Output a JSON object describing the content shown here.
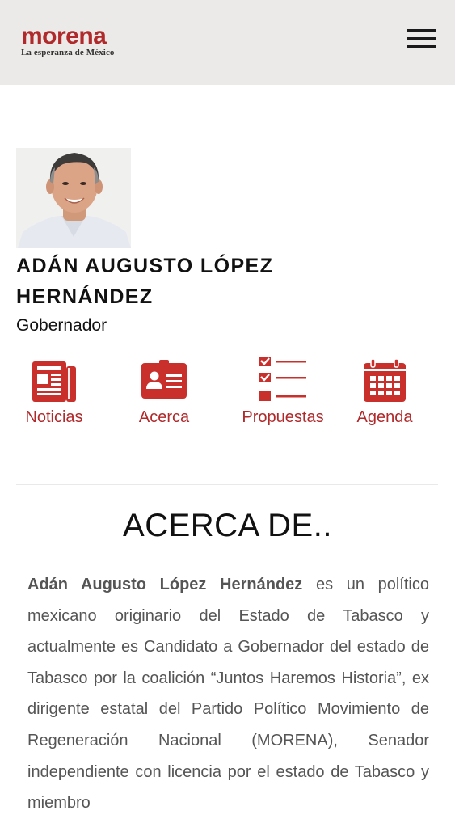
{
  "header": {
    "logo_word": "morena",
    "logo_tagline": "La esperanza de México",
    "menu_icon": "hamburger-icon"
  },
  "profile": {
    "name": "ADÁN AUGUSTO LÓPEZ HERNÁNDEZ",
    "role": "Gobernador",
    "photo": "candidate-portrait"
  },
  "nav": {
    "items": [
      {
        "label": "Noticias",
        "icon": "newspaper-icon"
      },
      {
        "label": "Acerca",
        "icon": "id-card-icon"
      },
      {
        "label": "Propuestas",
        "icon": "checklist-icon"
      },
      {
        "label": "Agenda",
        "icon": "calendar-icon"
      }
    ]
  },
  "colors": {
    "accent": "#b0292b",
    "header_bg": "#ebeae8",
    "body_text": "#555555"
  },
  "about": {
    "title": "ACERCA DE..",
    "lead": "Adán Augusto López Hernández",
    "body": " es un político mexicano originario del Estado de Tabasco y actualmente es Candidato a Gobernador del estado de Tabasco por la coalición “Juntos Haremos Historia”, ex dirigente estatal del Partido Político Movimiento de Regeneración Nacional (MORENA), Senador independiente con licencia por el estado de Tabasco y miembro"
  }
}
